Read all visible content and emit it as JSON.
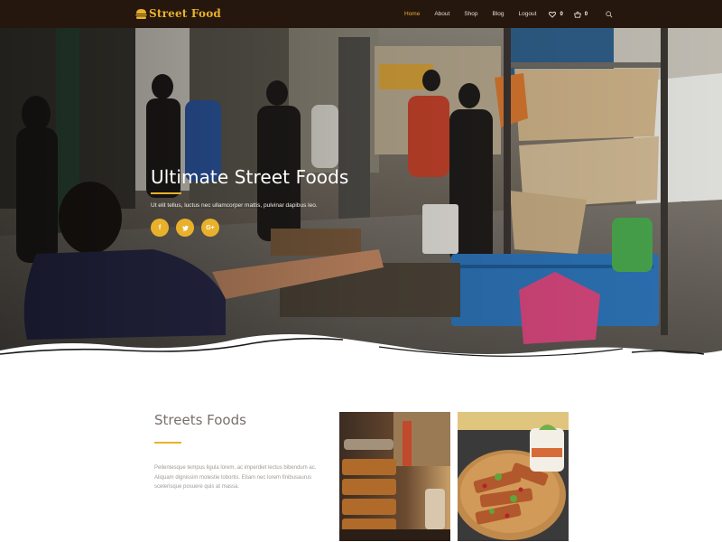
{
  "brand": {
    "name": "Street Food",
    "accent": "#e9b12b",
    "header_bg": "#25160e"
  },
  "nav": {
    "items": [
      "Home",
      "About",
      "Shop",
      "Blog",
      "Logout"
    ],
    "active": "Home",
    "wishlist_count": "0",
    "cart_count": "0",
    "icons": [
      "heart-icon",
      "shopping-basket-icon",
      "search-icon"
    ]
  },
  "hero": {
    "title": "Ultimate Street Foods",
    "subtitle": "Ut elit tellus, luctus nec ullamcorper mattis, pulvinar dapibus leo.",
    "social": [
      {
        "name": "facebook",
        "glyph": "f"
      },
      {
        "name": "twitter",
        "glyph": "t"
      },
      {
        "name": "google-plus",
        "glyph": "G+"
      }
    ]
  },
  "section": {
    "title": "Streets Foods",
    "body": "Pellentesque tempus ligula lorem, ac imperdiet lectus bibendum ac. Aliquam dignissim molestie lobortis. Etiam nec lorem finibusaurus scelerisque posuere quis at massa."
  }
}
